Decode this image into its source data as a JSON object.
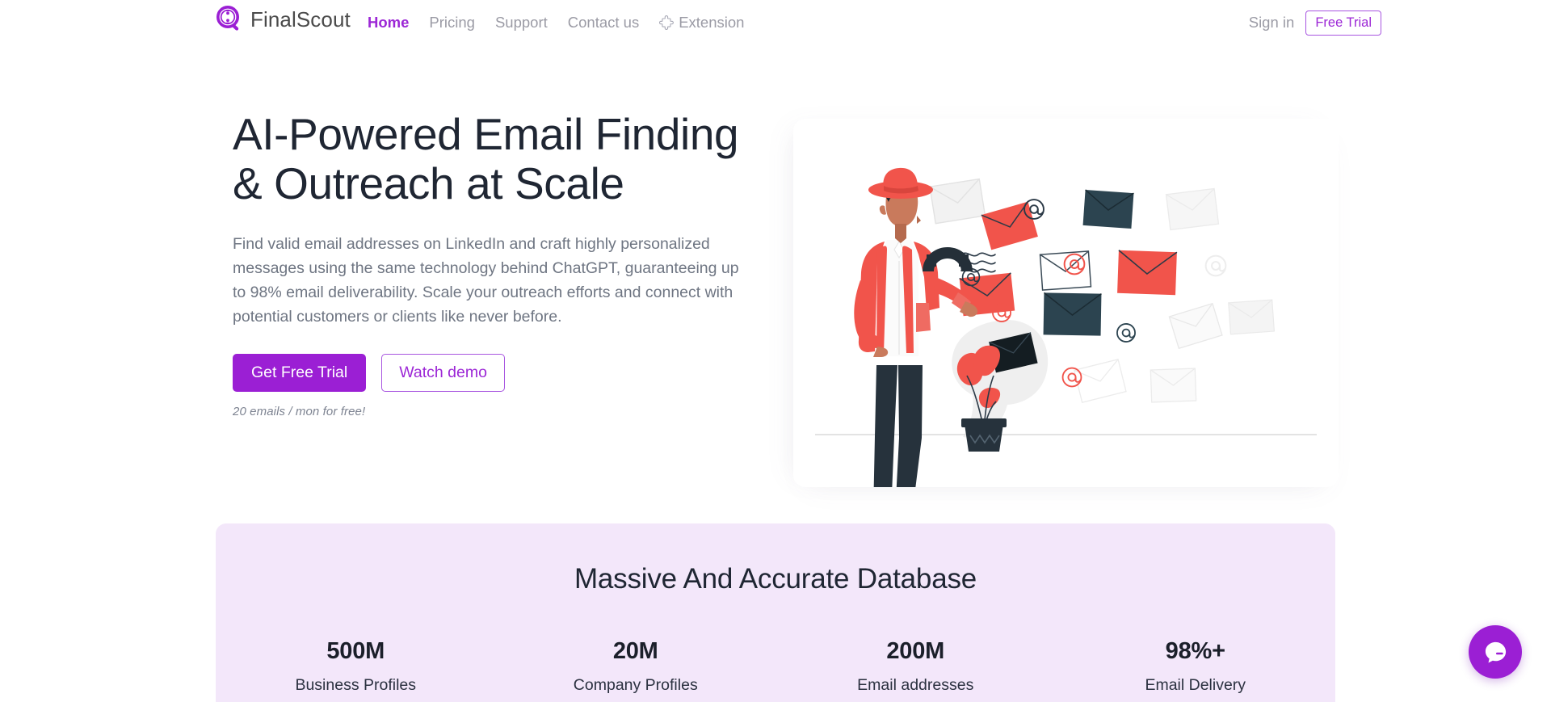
{
  "header": {
    "brand_name": "FinalScout",
    "logo_icon": "magnifier-logo-icon",
    "nav": [
      {
        "label": "Home",
        "active": true
      },
      {
        "label": "Pricing",
        "active": false
      },
      {
        "label": "Support",
        "active": false
      },
      {
        "label": "Contact us",
        "active": false
      }
    ],
    "extension_label": "Extension",
    "extension_icon": "puzzle-piece-icon",
    "signin_label": "Sign in",
    "free_trial_label": "Free Trial"
  },
  "hero": {
    "title": "AI-Powered Email Finding & Outreach at Scale",
    "subtitle": "Find valid email addresses on LinkedIn and craft highly personalized messages using the same technology behind ChatGPT, guaranteeing up to 98% email deliverability. Scale your outreach efforts and connect with potential customers or clients like never before.",
    "primary_cta": "Get Free Trial",
    "secondary_cta": "Watch demo",
    "note": "20 emails / mon for free!",
    "illustration_name": "email-magnet-illustration"
  },
  "stats": {
    "title": "Massive And Accurate Database",
    "items": [
      {
        "value": "500M",
        "label": "Business Profiles"
      },
      {
        "value": "20M",
        "label": "Company Profiles"
      },
      {
        "value": "200M",
        "label": "Email addresses"
      },
      {
        "value": "98%+",
        "label": "Email Delivery"
      }
    ]
  },
  "chat": {
    "icon": "chat-bubble-icon"
  },
  "colors": {
    "brand_purple": "#9b1fd4",
    "nav_active": "#9c27d6",
    "nav_muted": "#9b9ba5",
    "heading": "#1f2633",
    "body_text": "#6e7582",
    "stats_bg": "#f3e7fa",
    "illustration_red": "#f1544b",
    "illustration_dark": "#2c3a47"
  }
}
